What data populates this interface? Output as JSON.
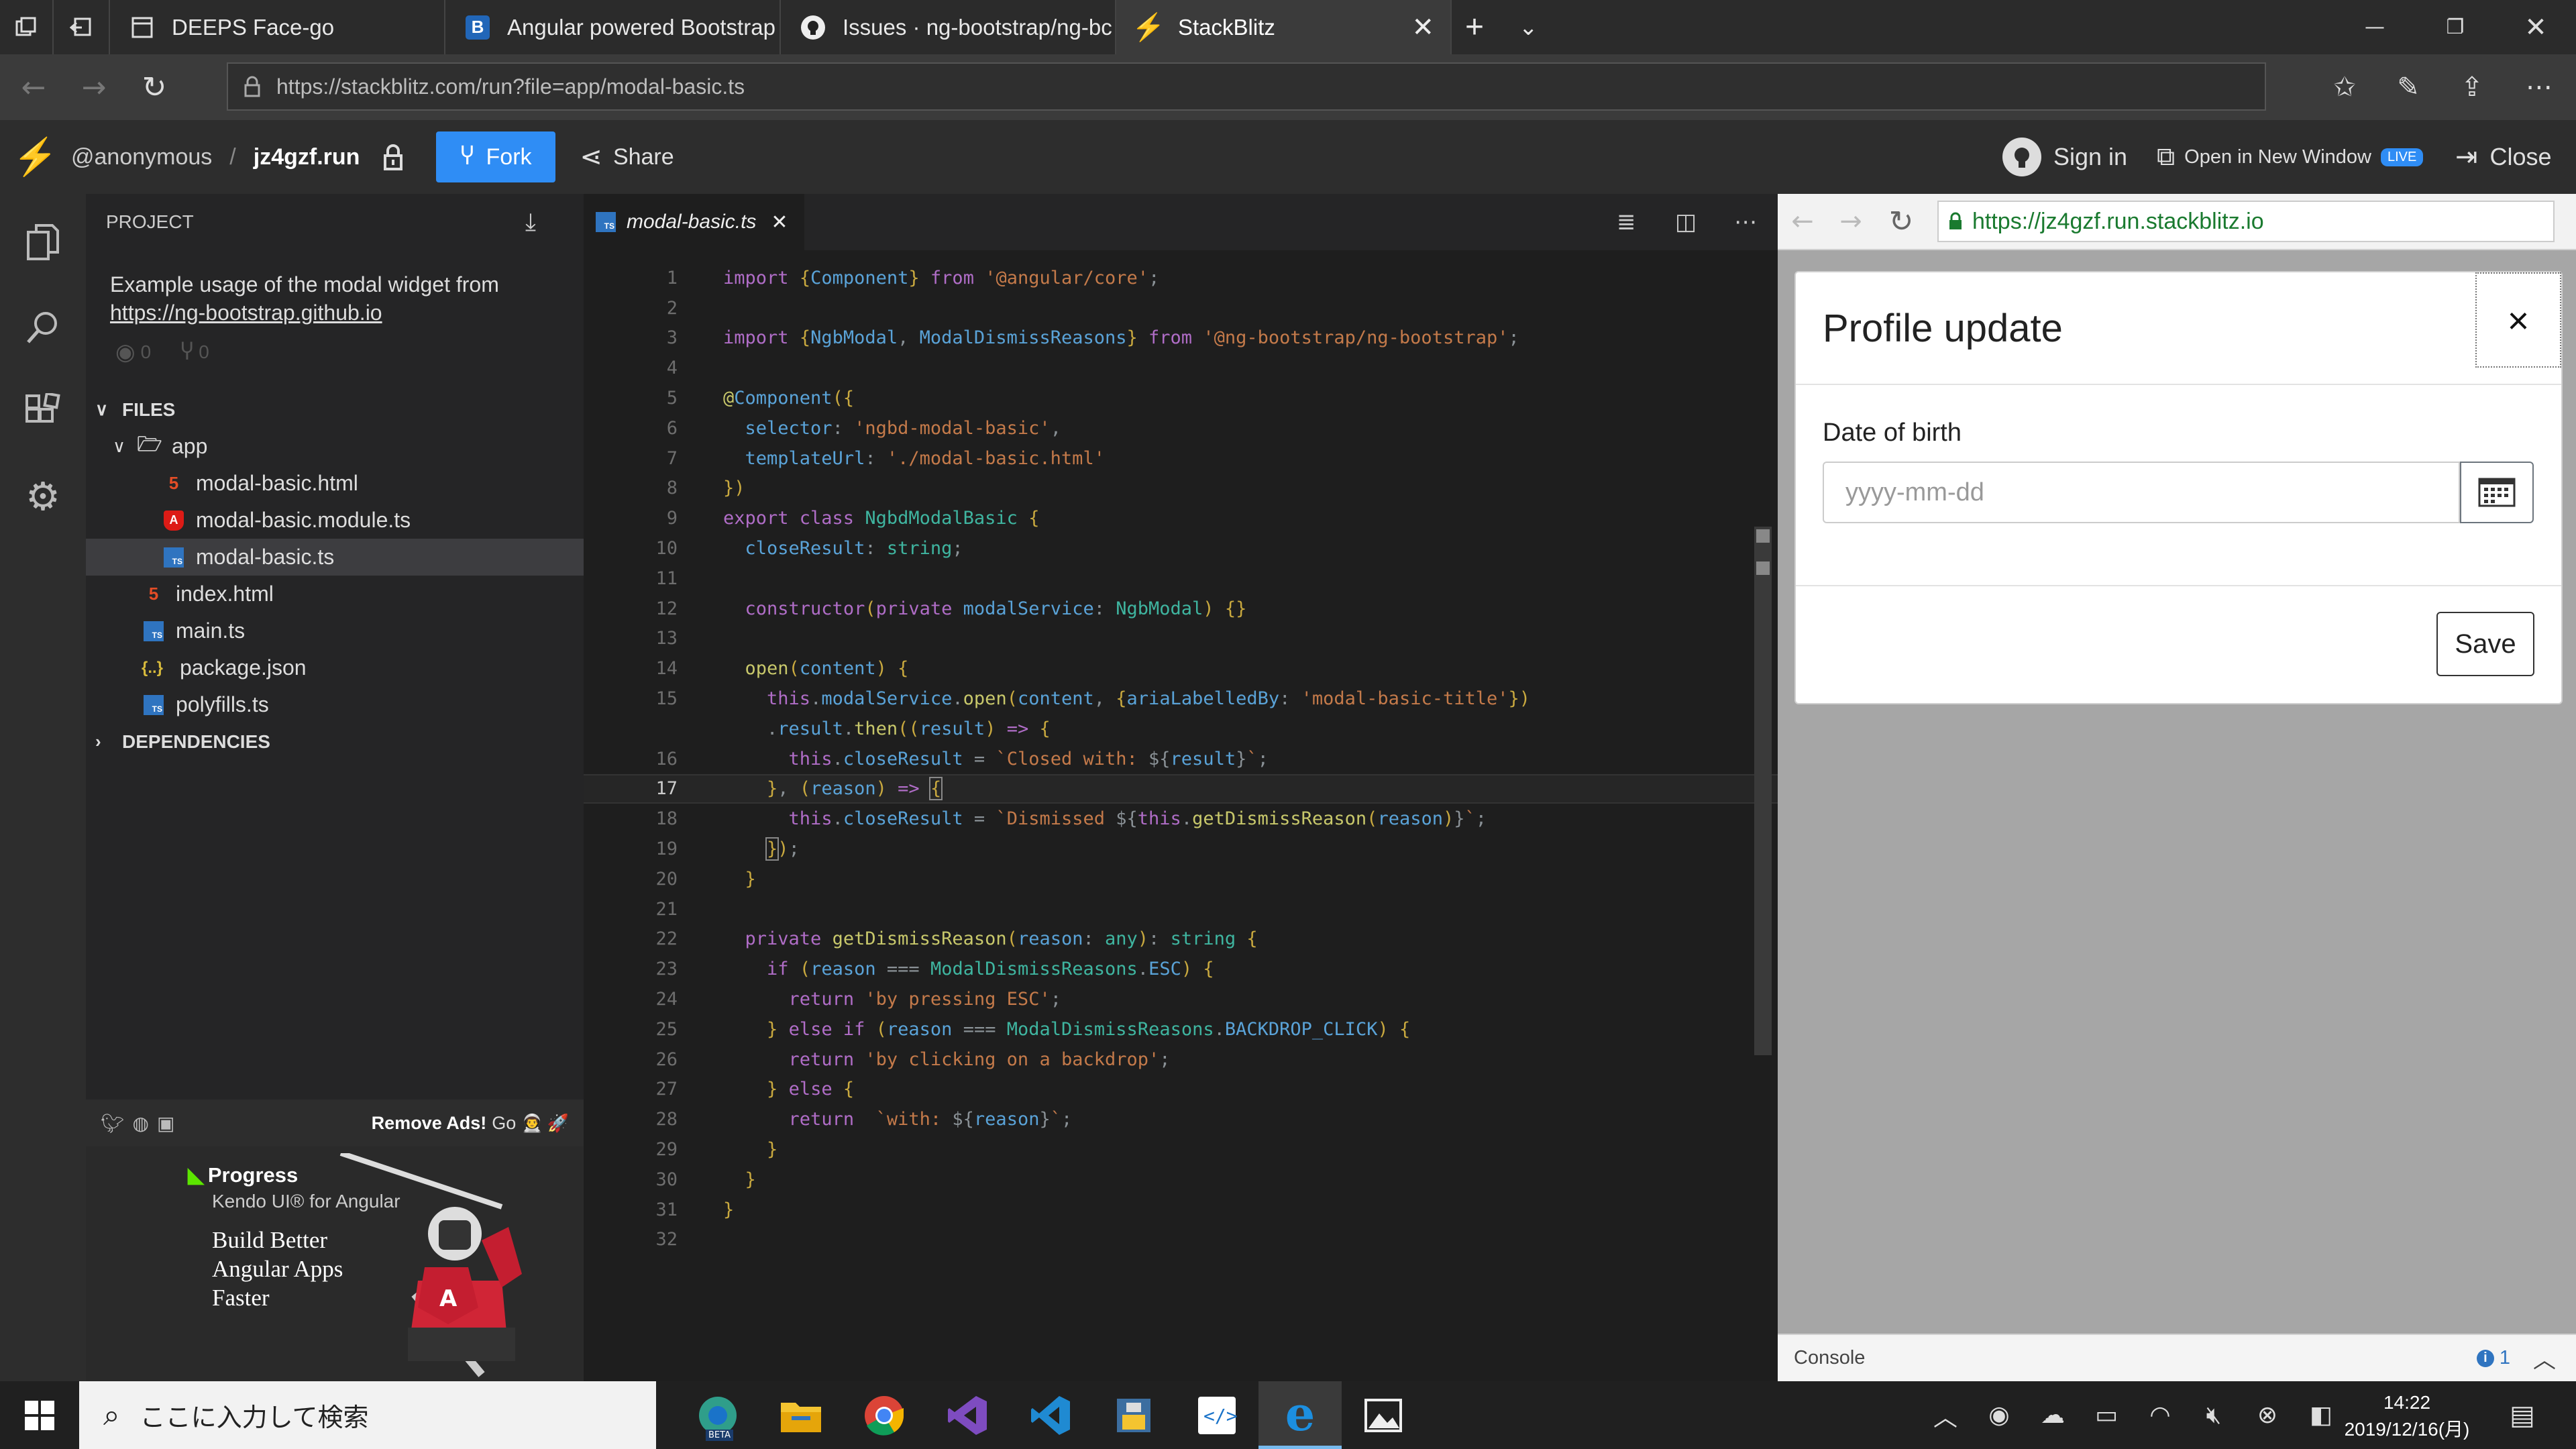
{
  "browser": {
    "tabs": [
      {
        "label": "DEEPS Face-go"
      },
      {
        "label": "Angular powered Bootstrap"
      },
      {
        "label": "Issues · ng-bootstrap/ng-bc"
      },
      {
        "label": "StackBlitz"
      }
    ],
    "url": "https://stackblitz.com/run?file=app/modal-basic.ts"
  },
  "stackblitz": {
    "user": "@anonymous",
    "separator": "/",
    "project_id": "jz4gzf.run",
    "fork_label": "Fork",
    "share_label": "Share",
    "sign_in_label": "Sign in",
    "open_new_window_label": "Open in New Window",
    "live_badge": "LIVE",
    "close_label": "Close"
  },
  "explorer": {
    "project_header": "PROJECT",
    "description": "Example usage of the modal widget from",
    "link": "https://ng-bootstrap.github.io",
    "views": "0",
    "forks": "0",
    "files_header": "FILES",
    "folder": "app",
    "files": [
      {
        "name": "modal-basic.html",
        "icon": "html-icon",
        "color": "#e44d26"
      },
      {
        "name": "modal-basic.module.ts",
        "icon": "angular-icon",
        "color": "#dd1b16"
      },
      {
        "name": "modal-basic.ts",
        "icon": "ts-icon",
        "color": "#2f74c0"
      }
    ],
    "root_files": [
      {
        "name": "index.html",
        "icon": "html-icon",
        "color": "#e44d26"
      },
      {
        "name": "main.ts",
        "icon": "ts-icon",
        "color": "#2f74c0"
      },
      {
        "name": "package.json",
        "icon": "json-icon",
        "color": "#d7ba3c"
      },
      {
        "name": "polyfills.ts",
        "icon": "ts-icon",
        "color": "#2f74c0"
      }
    ],
    "dependencies_header": "DEPENDENCIES",
    "ads_label": "Remove Ads!",
    "ads_go": "Go",
    "ad": {
      "brand": "Progress",
      "product": "Kendo UI® for Angular",
      "line1": "Build Better",
      "line2": "Angular Apps",
      "line3": "Faster",
      "logo_letter": "A"
    }
  },
  "editor": {
    "active_file": "modal-basic.ts",
    "tab_icon_text": "TS",
    "line_numbers": [
      "1",
      "2",
      "3",
      "4",
      "5",
      "6",
      "7",
      "8",
      "9",
      "10",
      "11",
      "12",
      "13",
      "14",
      "15",
      "",
      "16",
      "17",
      "18",
      "19",
      "20",
      "21",
      "22",
      "23",
      "24",
      "25",
      "26",
      "27",
      "28",
      "29",
      "30",
      "31",
      "32"
    ]
  },
  "preview": {
    "url": "https://jz4gzf.run.stackblitz.io",
    "modal_title": "Profile update",
    "close_glyph": "×",
    "dob_label": "Date of birth",
    "dob_placeholder": "yyyy-mm-dd",
    "save_label": "Save",
    "console_label": "Console",
    "console_count": "1"
  },
  "taskbar": {
    "search_placeholder": "ここに入力して検索",
    "time": "14:22",
    "date": "2019/12/16(月)",
    "edge_badge": "BETA"
  },
  "colors": {
    "accent": "#2f8df5",
    "editor_bg": "#1e1e1e",
    "sidebar_bg": "#252526"
  }
}
